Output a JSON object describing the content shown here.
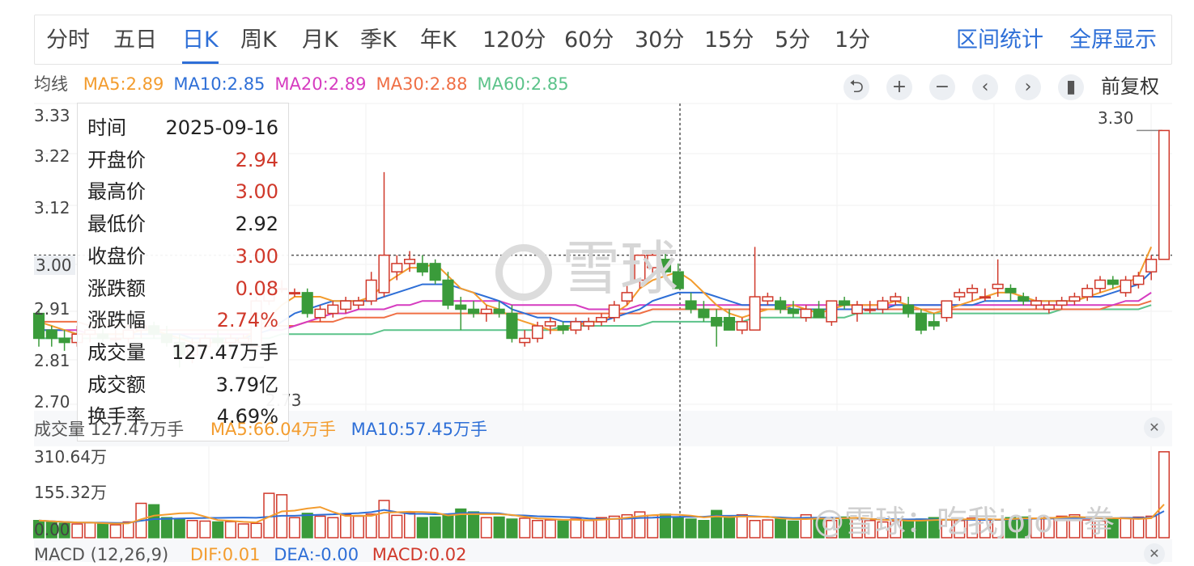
{
  "tabs": [
    {
      "label": "分时",
      "active": false
    },
    {
      "label": "五日",
      "active": false
    },
    {
      "label": "日K",
      "active": true
    },
    {
      "label": "周K",
      "active": false
    },
    {
      "label": "月K",
      "active": false
    },
    {
      "label": "季K",
      "active": false
    },
    {
      "label": "年K",
      "active": false
    },
    {
      "label": "120分",
      "active": false
    },
    {
      "label": "60分",
      "active": false
    },
    {
      "label": "30分",
      "active": false
    },
    {
      "label": "15分",
      "active": false
    },
    {
      "label": "5分",
      "active": false
    },
    {
      "label": "1分",
      "active": false
    }
  ],
  "links": {
    "range_stats": "区间统计",
    "fullscreen": "全屏显示"
  },
  "ma": {
    "label": "均线",
    "items": [
      {
        "text": "MA5:2.89",
        "color": "#f39c2e"
      },
      {
        "text": "MA10:2.85",
        "color": "#2e6fd7"
      },
      {
        "text": "MA20:2.89",
        "color": "#d63cc0"
      },
      {
        "text": "MA30:2.88",
        "color": "#ef6f45"
      },
      {
        "text": "MA60:2.85",
        "color": "#5cc38a"
      }
    ]
  },
  "controls": {
    "reset": "⮌",
    "zoom_in": "+",
    "zoom_out": "−",
    "prev": "‹",
    "next": "›",
    "toggle": "▮"
  },
  "adjust_label": "前复权",
  "price_axis": [
    "3.33",
    "3.22",
    "3.12",
    "3.00",
    "2.91",
    "2.81",
    "2.70"
  ],
  "latest_high_label": "3.30",
  "low_marker_label": "2.73",
  "tooltip": {
    "rows": [
      {
        "k": "时间",
        "v": "2025-09-16",
        "color": "#222"
      },
      {
        "k": "开盘价",
        "v": "2.94",
        "color": "#d0392b"
      },
      {
        "k": "最高价",
        "v": "3.00",
        "color": "#d0392b"
      },
      {
        "k": "最低价",
        "v": "2.92",
        "color": "#222"
      },
      {
        "k": "收盘价",
        "v": "3.00",
        "color": "#d0392b"
      },
      {
        "k": "涨跌额",
        "v": "0.08",
        "color": "#d0392b"
      },
      {
        "k": "涨跌幅",
        "v": "2.74%",
        "color": "#d0392b"
      },
      {
        "k": "成交量",
        "v": "127.47万手",
        "color": "#222"
      },
      {
        "k": "成交额",
        "v": "3.79亿",
        "color": "#222"
      },
      {
        "k": "换手率",
        "v": "4.69%",
        "color": "#222"
      }
    ]
  },
  "volume": {
    "label": "成交量 127.47万手",
    "ma5": "MA5:66.04万手",
    "ma10": "MA10:57.45万手",
    "axis": [
      "310.64万",
      "155.32万",
      "0.00"
    ]
  },
  "macd": {
    "label": "MACD (12,26,9)",
    "dif": "DIF:0.01",
    "dea": "DEA:-0.00",
    "macd": "MACD:0.02"
  },
  "watermark": {
    "main": "雪球",
    "footer": "@雪球：吃我jojo一拳"
  },
  "colors": {
    "up": "#d0392b",
    "down": "#3a9b3a",
    "accent": "#2e6fd7",
    "ma5": "#f39c2e",
    "ma10": "#2e6fd7",
    "ma20": "#d63cc0",
    "ma30": "#ef6f45",
    "ma60": "#5cc38a"
  },
  "chart_data": {
    "type": "candlestick",
    "ylim": [
      2.7,
      3.33
    ],
    "reference_close": 3.0,
    "candles": [
      {
        "o": 2.86,
        "h": 2.87,
        "l": 2.78,
        "c": 2.8
      },
      {
        "o": 2.82,
        "h": 2.83,
        "l": 2.78,
        "c": 2.8
      },
      {
        "o": 2.8,
        "h": 2.82,
        "l": 2.77,
        "c": 2.79
      },
      {
        "o": 2.79,
        "h": 2.83,
        "l": 2.78,
        "c": 2.81
      },
      {
        "o": 2.81,
        "h": 2.84,
        "l": 2.79,
        "c": 2.82
      },
      {
        "o": 2.81,
        "h": 2.83,
        "l": 2.79,
        "c": 2.8
      },
      {
        "o": 2.8,
        "h": 2.82,
        "l": 2.79,
        "c": 2.8
      },
      {
        "o": 2.8,
        "h": 2.83,
        "l": 2.78,
        "c": 2.82
      },
      {
        "o": 2.82,
        "h": 2.84,
        "l": 2.8,
        "c": 2.83
      },
      {
        "o": 2.83,
        "h": 2.84,
        "l": 2.8,
        "c": 2.81
      },
      {
        "o": 2.81,
        "h": 2.83,
        "l": 2.78,
        "c": 2.79
      },
      {
        "o": 2.79,
        "h": 2.81,
        "l": 2.73,
        "c": 2.76
      },
      {
        "o": 2.76,
        "h": 2.8,
        "l": 2.74,
        "c": 2.78
      },
      {
        "o": 2.78,
        "h": 2.81,
        "l": 2.76,
        "c": 2.8
      },
      {
        "o": 2.8,
        "h": 2.82,
        "l": 2.78,
        "c": 2.79
      },
      {
        "o": 2.79,
        "h": 2.81,
        "l": 2.77,
        "c": 2.8
      },
      {
        "o": 2.79,
        "h": 2.81,
        "l": 2.78,
        "c": 2.8
      },
      {
        "o": 2.78,
        "h": 2.9,
        "l": 2.78,
        "c": 2.89
      },
      {
        "o": 2.89,
        "h": 2.93,
        "l": 2.88,
        "c": 2.93
      },
      {
        "o": 2.92,
        "h": 2.94,
        "l": 2.91,
        "c": 2.92
      },
      {
        "o": 2.91,
        "h": 2.92,
        "l": 2.9,
        "c": 2.91
      },
      {
        "o": 2.91,
        "h": 2.92,
        "l": 2.85,
        "c": 2.86
      },
      {
        "o": 2.85,
        "h": 2.88,
        "l": 2.84,
        "c": 2.87
      },
      {
        "o": 2.86,
        "h": 2.89,
        "l": 2.85,
        "c": 2.88
      },
      {
        "o": 2.87,
        "h": 2.9,
        "l": 2.86,
        "c": 2.89
      },
      {
        "o": 2.88,
        "h": 2.9,
        "l": 2.87,
        "c": 2.89
      },
      {
        "o": 2.89,
        "h": 2.96,
        "l": 2.88,
        "c": 2.94
      },
      {
        "o": 2.91,
        "h": 3.2,
        "l": 2.9,
        "c": 3.0
      },
      {
        "o": 2.96,
        "h": 3.0,
        "l": 2.94,
        "c": 2.98
      },
      {
        "o": 2.98,
        "h": 3.01,
        "l": 2.96,
        "c": 2.99
      },
      {
        "o": 2.98,
        "h": 3.0,
        "l": 2.95,
        "c": 2.96
      },
      {
        "o": 2.98,
        "h": 2.99,
        "l": 2.93,
        "c": 2.94
      },
      {
        "o": 2.94,
        "h": 2.96,
        "l": 2.87,
        "c": 2.88
      },
      {
        "o": 2.88,
        "h": 2.9,
        "l": 2.82,
        "c": 2.87
      },
      {
        "o": 2.87,
        "h": 2.89,
        "l": 2.85,
        "c": 2.86
      },
      {
        "o": 2.86,
        "h": 2.88,
        "l": 2.84,
        "c": 2.87
      },
      {
        "o": 2.87,
        "h": 2.89,
        "l": 2.85,
        "c": 2.86
      },
      {
        "o": 2.86,
        "h": 2.88,
        "l": 2.79,
        "c": 2.8
      },
      {
        "o": 2.79,
        "h": 2.82,
        "l": 2.78,
        "c": 2.8
      },
      {
        "o": 2.8,
        "h": 2.84,
        "l": 2.79,
        "c": 2.83
      },
      {
        "o": 2.83,
        "h": 2.85,
        "l": 2.81,
        "c": 2.84
      },
      {
        "o": 2.83,
        "h": 2.84,
        "l": 2.81,
        "c": 2.82
      },
      {
        "o": 2.82,
        "h": 2.85,
        "l": 2.81,
        "c": 2.84
      },
      {
        "o": 2.83,
        "h": 2.85,
        "l": 2.82,
        "c": 2.84
      },
      {
        "o": 2.84,
        "h": 2.86,
        "l": 2.83,
        "c": 2.85
      },
      {
        "o": 2.85,
        "h": 2.89,
        "l": 2.84,
        "c": 2.88
      },
      {
        "o": 2.89,
        "h": 2.93,
        "l": 2.88,
        "c": 2.91
      },
      {
        "o": 2.94,
        "h": 3.0,
        "l": 2.92,
        "c": 3.0
      },
      {
        "o": 2.97,
        "h": 3.01,
        "l": 2.95,
        "c": 3.0
      },
      {
        "o": 2.99,
        "h": 3.01,
        "l": 2.94,
        "c": 2.96
      },
      {
        "o": 2.96,
        "h": 2.98,
        "l": 2.92,
        "c": 2.92
      },
      {
        "o": 2.89,
        "h": 2.91,
        "l": 2.86,
        "c": 2.87
      },
      {
        "o": 2.87,
        "h": 2.89,
        "l": 2.84,
        "c": 2.85
      },
      {
        "o": 2.85,
        "h": 2.87,
        "l": 2.78,
        "c": 2.83
      },
      {
        "o": 2.85,
        "h": 2.87,
        "l": 2.82,
        "c": 2.82
      },
      {
        "o": 2.82,
        "h": 2.85,
        "l": 2.81,
        "c": 2.84
      },
      {
        "o": 2.82,
        "h": 3.02,
        "l": 2.82,
        "c": 2.9
      },
      {
        "o": 2.89,
        "h": 2.91,
        "l": 2.88,
        "c": 2.9
      },
      {
        "o": 2.89,
        "h": 2.9,
        "l": 2.86,
        "c": 2.87
      },
      {
        "o": 2.87,
        "h": 2.89,
        "l": 2.85,
        "c": 2.86
      },
      {
        "o": 2.85,
        "h": 2.88,
        "l": 2.84,
        "c": 2.87
      },
      {
        "o": 2.87,
        "h": 2.89,
        "l": 2.85,
        "c": 2.85
      },
      {
        "o": 2.84,
        "h": 2.89,
        "l": 2.83,
        "c": 2.89
      },
      {
        "o": 2.89,
        "h": 2.9,
        "l": 2.87,
        "c": 2.88
      },
      {
        "o": 2.86,
        "h": 2.89,
        "l": 2.84,
        "c": 2.88
      },
      {
        "o": 2.87,
        "h": 2.89,
        "l": 2.86,
        "c": 2.87
      },
      {
        "o": 2.87,
        "h": 2.9,
        "l": 2.86,
        "c": 2.89
      },
      {
        "o": 2.89,
        "h": 2.91,
        "l": 2.88,
        "c": 2.9
      },
      {
        "o": 2.88,
        "h": 2.9,
        "l": 2.85,
        "c": 2.86
      },
      {
        "o": 2.86,
        "h": 2.87,
        "l": 2.81,
        "c": 2.82
      },
      {
        "o": 2.84,
        "h": 2.86,
        "l": 2.82,
        "c": 2.83
      },
      {
        "o": 2.85,
        "h": 2.89,
        "l": 2.84,
        "c": 2.89
      },
      {
        "o": 2.9,
        "h": 2.92,
        "l": 2.89,
        "c": 2.91
      },
      {
        "o": 2.91,
        "h": 2.93,
        "l": 2.89,
        "c": 2.92
      },
      {
        "o": 2.9,
        "h": 2.92,
        "l": 2.89,
        "c": 2.9
      },
      {
        "o": 2.92,
        "h": 2.99,
        "l": 2.9,
        "c": 2.93
      },
      {
        "o": 2.92,
        "h": 2.93,
        "l": 2.89,
        "c": 2.91
      },
      {
        "o": 2.9,
        "h": 2.91,
        "l": 2.88,
        "c": 2.89
      },
      {
        "o": 2.88,
        "h": 2.9,
        "l": 2.87,
        "c": 2.89
      },
      {
        "o": 2.87,
        "h": 2.89,
        "l": 2.86,
        "c": 2.88
      },
      {
        "o": 2.88,
        "h": 2.9,
        "l": 2.87,
        "c": 2.89
      },
      {
        "o": 2.89,
        "h": 2.91,
        "l": 2.88,
        "c": 2.9
      },
      {
        "o": 2.9,
        "h": 2.93,
        "l": 2.89,
        "c": 2.92
      },
      {
        "o": 2.92,
        "h": 2.95,
        "l": 2.91,
        "c": 2.94
      },
      {
        "o": 2.94,
        "h": 2.95,
        "l": 2.92,
        "c": 2.93
      },
      {
        "o": 2.91,
        "h": 2.95,
        "l": 2.9,
        "c": 2.94
      },
      {
        "o": 2.93,
        "h": 2.96,
        "l": 2.92,
        "c": 2.95
      },
      {
        "o": 2.96,
        "h": 3.0,
        "l": 2.94,
        "c": 2.99
      },
      {
        "o": 2.99,
        "h": 3.3,
        "l": 2.99,
        "c": 3.3
      }
    ],
    "volume": [
      60,
      55,
      50,
      48,
      52,
      50,
      45,
      55,
      120,
      115,
      70,
      65,
      60,
      58,
      55,
      56,
      48,
      50,
      155,
      150,
      70,
      85,
      75,
      70,
      80,
      75,
      82,
      130,
      78,
      88,
      70,
      72,
      80,
      100,
      90,
      70,
      72,
      65,
      68,
      60,
      62,
      58,
      65,
      60,
      70,
      75,
      80,
      90,
      78,
      82,
      70,
      65,
      60,
      95,
      70,
      80,
      60,
      62,
      65,
      58,
      80,
      70,
      60,
      72,
      66,
      60,
      55,
      58,
      60,
      65,
      70,
      62,
      60,
      68,
      65,
      62,
      70,
      72,
      68,
      70,
      75,
      80,
      62,
      58,
      65,
      70,
      72,
      75,
      300
    ],
    "ma5": [
      2.84,
      2.83,
      2.82,
      2.81,
      2.81,
      2.81,
      2.81,
      2.81,
      2.82,
      2.82,
      2.81,
      2.8,
      2.79,
      2.79,
      2.79,
      2.79,
      2.8,
      2.82,
      2.85,
      2.88,
      2.9,
      2.9,
      2.9,
      2.89,
      2.89,
      2.89,
      2.9,
      2.93,
      2.95,
      2.97,
      2.97,
      2.98,
      2.95,
      2.92,
      2.91,
      2.88,
      2.87,
      2.85,
      2.84,
      2.83,
      2.82,
      2.82,
      2.83,
      2.84,
      2.84,
      2.86,
      2.88,
      2.92,
      2.94,
      2.95,
      2.96,
      2.94,
      2.91,
      2.88,
      2.86,
      2.85,
      2.86,
      2.87,
      2.87,
      2.88,
      2.87,
      2.86,
      2.87,
      2.88,
      2.88,
      2.88,
      2.88,
      2.89,
      2.88,
      2.87,
      2.86,
      2.87,
      2.88,
      2.89,
      2.9,
      2.91,
      2.91,
      2.9,
      2.89,
      2.89,
      2.89,
      2.89,
      2.9,
      2.91,
      2.92,
      2.93,
      2.95,
      3.02
    ],
    "ma10": [
      2.82,
      2.82,
      2.82,
      2.81,
      2.81,
      2.81,
      2.81,
      2.81,
      2.81,
      2.81,
      2.81,
      2.81,
      2.8,
      2.8,
      2.8,
      2.8,
      2.8,
      2.81,
      2.82,
      2.84,
      2.86,
      2.87,
      2.88,
      2.89,
      2.89,
      2.89,
      2.89,
      2.9,
      2.91,
      2.92,
      2.93,
      2.93,
      2.93,
      2.92,
      2.91,
      2.9,
      2.89,
      2.87,
      2.86,
      2.85,
      2.85,
      2.84,
      2.84,
      2.84,
      2.84,
      2.85,
      2.86,
      2.87,
      2.89,
      2.9,
      2.91,
      2.91,
      2.91,
      2.9,
      2.89,
      2.88,
      2.88,
      2.88,
      2.88,
      2.87,
      2.87,
      2.87,
      2.87,
      2.87,
      2.87,
      2.87,
      2.87,
      2.88,
      2.88,
      2.88,
      2.88,
      2.88,
      2.88,
      2.88,
      2.89,
      2.89,
      2.89,
      2.89,
      2.89,
      2.89,
      2.89,
      2.89,
      2.9,
      2.9,
      2.91,
      2.92,
      2.93,
      2.96
    ],
    "ma20": [
      2.82,
      2.82,
      2.82,
      2.82,
      2.81,
      2.81,
      2.81,
      2.81,
      2.81,
      2.81,
      2.81,
      2.81,
      2.81,
      2.81,
      2.81,
      2.81,
      2.81,
      2.81,
      2.82,
      2.82,
      2.83,
      2.84,
      2.85,
      2.86,
      2.86,
      2.87,
      2.87,
      2.87,
      2.88,
      2.88,
      2.89,
      2.89,
      2.89,
      2.89,
      2.89,
      2.89,
      2.89,
      2.88,
      2.88,
      2.88,
      2.88,
      2.88,
      2.88,
      2.87,
      2.87,
      2.87,
      2.87,
      2.88,
      2.88,
      2.88,
      2.88,
      2.88,
      2.88,
      2.88,
      2.88,
      2.88,
      2.88,
      2.88,
      2.88,
      2.88,
      2.88,
      2.88,
      2.88,
      2.88,
      2.88,
      2.88,
      2.88,
      2.88,
      2.88,
      2.88,
      2.88,
      2.88,
      2.88,
      2.88,
      2.88,
      2.88,
      2.88,
      2.88,
      2.88,
      2.88,
      2.88,
      2.88,
      2.88,
      2.88,
      2.88,
      2.89,
      2.89,
      2.91
    ],
    "ma30": [
      2.84,
      2.84,
      2.84,
      2.84,
      2.83,
      2.83,
      2.83,
      2.83,
      2.83,
      2.82,
      2.82,
      2.82,
      2.82,
      2.82,
      2.82,
      2.82,
      2.82,
      2.82,
      2.83,
      2.83,
      2.83,
      2.84,
      2.84,
      2.84,
      2.85,
      2.85,
      2.85,
      2.85,
      2.86,
      2.86,
      2.86,
      2.86,
      2.86,
      2.86,
      2.86,
      2.86,
      2.86,
      2.86,
      2.86,
      2.86,
      2.86,
      2.86,
      2.86,
      2.86,
      2.86,
      2.86,
      2.86,
      2.86,
      2.87,
      2.87,
      2.87,
      2.87,
      2.87,
      2.87,
      2.87,
      2.87,
      2.87,
      2.87,
      2.87,
      2.87,
      2.87,
      2.87,
      2.87,
      2.87,
      2.87,
      2.87,
      2.87,
      2.87,
      2.87,
      2.87,
      2.87,
      2.87,
      2.87,
      2.87,
      2.87,
      2.87,
      2.87,
      2.87,
      2.87,
      2.87,
      2.87,
      2.87,
      2.87,
      2.87,
      2.88,
      2.88,
      2.88,
      2.89
    ],
    "ma60": [
      2.8,
      2.8,
      2.8,
      2.8,
      2.8,
      2.8,
      2.8,
      2.8,
      2.8,
      2.8,
      2.8,
      2.8,
      2.8,
      2.8,
      2.8,
      2.8,
      2.8,
      2.8,
      2.8,
      2.81,
      2.81,
      2.81,
      2.81,
      2.81,
      2.81,
      2.81,
      2.81,
      2.82,
      2.82,
      2.82,
      2.82,
      2.82,
      2.82,
      2.82,
      2.82,
      2.82,
      2.82,
      2.82,
      2.82,
      2.82,
      2.82,
      2.83,
      2.83,
      2.83,
      2.83,
      2.83,
      2.83,
      2.83,
      2.84,
      2.84,
      2.84,
      2.84,
      2.84,
      2.84,
      2.84,
      2.84,
      2.85,
      2.85,
      2.85,
      2.85,
      2.85,
      2.85,
      2.85,
      2.85,
      2.86,
      2.86,
      2.86,
      2.86,
      2.86,
      2.86,
      2.86,
      2.86,
      2.86,
      2.86,
      2.86,
      2.86,
      2.86,
      2.86,
      2.86,
      2.86,
      2.87,
      2.87,
      2.87,
      2.87,
      2.87,
      2.87,
      2.87,
      2.88
    ],
    "volume_ylim": [
      0,
      310.64
    ],
    "volume_unit": "万手",
    "crosshair_index": 46
  }
}
